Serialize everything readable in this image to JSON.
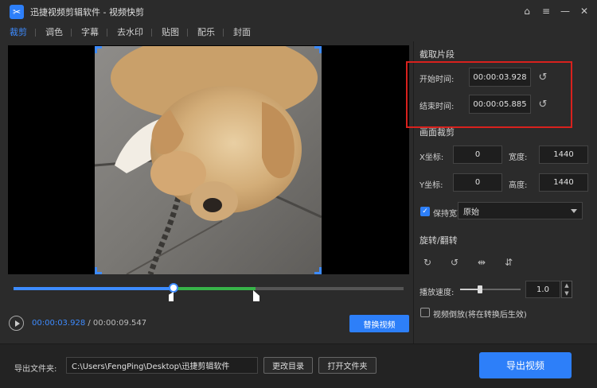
{
  "window": {
    "app_title": "迅捷视频剪辑软件 - 视频快剪",
    "controls": {
      "home": "⌂",
      "menu": "≡",
      "minimize": "—",
      "close": "✕"
    }
  },
  "tabs": [
    {
      "label": "裁剪",
      "active": true
    },
    {
      "label": "调色"
    },
    {
      "label": "字幕"
    },
    {
      "label": "去水印"
    },
    {
      "label": "贴图"
    },
    {
      "label": "配乐"
    },
    {
      "label": "封面"
    }
  ],
  "player": {
    "current_time": "00:00:03.928",
    "separator": " / ",
    "total_time": "00:00:09.547",
    "replace_label": "替换视频",
    "played_fraction": 0.41,
    "selection_end_fraction": 0.62
  },
  "clip": {
    "section_title": "截取片段",
    "start_label": "开始时间:",
    "start_value": "00:00:03.928",
    "end_label": "结束时间:",
    "end_value": "00:00:05.885"
  },
  "crop": {
    "section_title": "画面裁剪",
    "x_label": "X坐标:",
    "x_value": "0",
    "width_label": "宽度:",
    "width_value": "1440",
    "y_label": "Y坐标:",
    "y_value": "0",
    "height_label": "高度:",
    "height_value": "1440",
    "keep_ratio_label": "保持宽高比",
    "keep_ratio_checked": true,
    "ratio_value": "原始"
  },
  "rotate": {
    "section_title": "旋转/翻转"
  },
  "speed": {
    "label": "播放速度:",
    "value": "1.0",
    "level_fraction": 0.33
  },
  "reverse": {
    "label": "视频倒放(将在转换后生效)",
    "checked": false
  },
  "footer": {
    "folder_label": "导出文件夹:",
    "folder_path": "C:\\Users\\FengPing\\Desktop\\迅捷剪辑软件",
    "change_dir_label": "更改目录",
    "open_folder_label": "打开文件夹",
    "export_label": "导出视频"
  },
  "colors": {
    "accent": "#2d7ff9",
    "selection": "#38b449",
    "highlight": "#d8211d",
    "background": "#2b2b2b"
  }
}
